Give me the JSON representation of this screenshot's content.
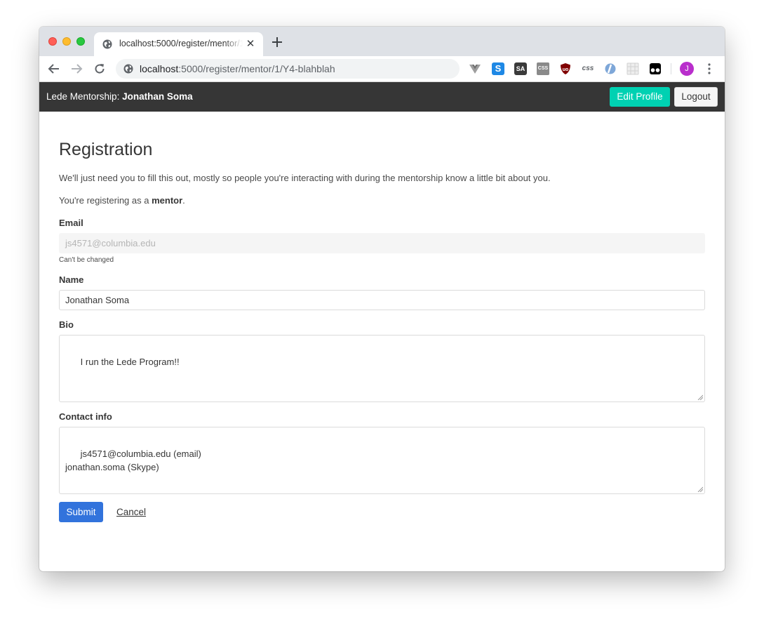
{
  "browser": {
    "tab_title": "localhost:5000/register/mentor/1/Y4-blahblah",
    "url_host": "localhost",
    "url_rest": ":5000/register/mentor/1/Y4-blahblah",
    "profile_initial": "J",
    "extensions": [
      "vue-devtools-icon",
      "s-extension-icon",
      "sa-extension-icon",
      "css-viewer-icon",
      "ublock-origin-icon",
      "css-extension-icon",
      "ie-tab-icon",
      "grid-extension-icon",
      "tampermonkey-icon"
    ],
    "extension_labels": {
      "s": "S",
      "sa": "SA",
      "css": "CSS",
      "ub": "uo"
    }
  },
  "navbar": {
    "brand_prefix": "Lede Mentorship: ",
    "brand_name": "Jonathan Soma",
    "edit_profile_label": "Edit Profile",
    "logout_label": "Logout"
  },
  "page": {
    "title": "Registration",
    "intro": "We'll just need you to fill this out, mostly so people you're interacting with during the mentorship know a little bit about you.",
    "role_prefix": "You're registering as a ",
    "role": "mentor",
    "role_suffix": "."
  },
  "form": {
    "email_label": "Email",
    "email_value": "js4571@columbia.edu",
    "email_help": "Can't be changed",
    "name_label": "Name",
    "name_value": "Jonathan Soma",
    "bio_label": "Bio",
    "bio_value": "I run the Lede Program!!",
    "contact_label": "Contact info",
    "contact_value": "js4571@columbia.edu (email)\njonathan.soma (Skype)",
    "submit_label": "Submit",
    "cancel_label": "Cancel"
  },
  "colors": {
    "navbar_bg": "#363636",
    "edit_profile_bg": "#00d1b2",
    "submit_bg": "#3273dc"
  }
}
